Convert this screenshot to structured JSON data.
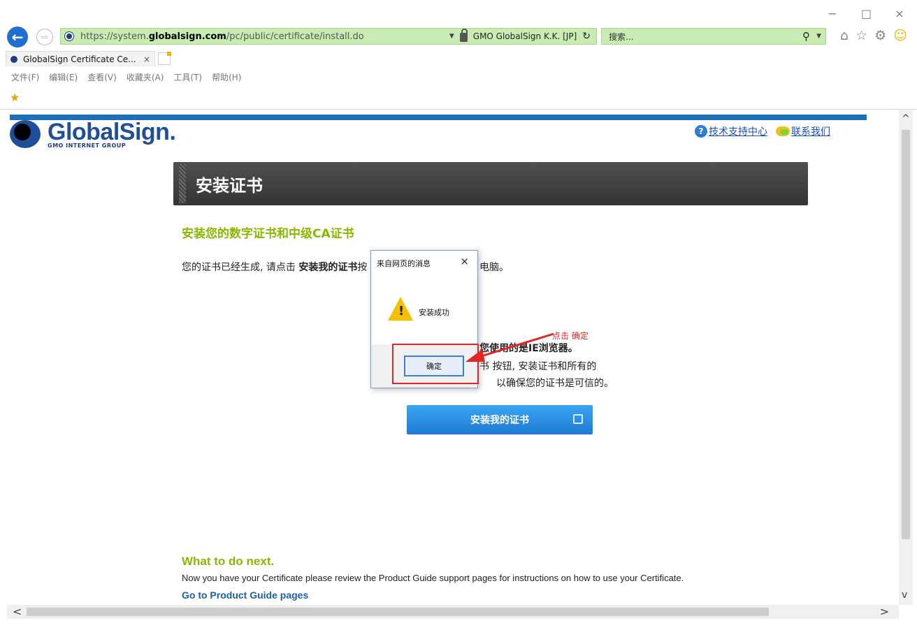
{
  "window": {
    "minimize": "−",
    "maximize": "□",
    "close": "×"
  },
  "address_bar": {
    "url_scheme": "https://",
    "url_sub": "system.",
    "url_host": "globalsign.com",
    "url_path": "/pc/public/certificate/install.do",
    "cert_org": "GMO GlobalSign K.K. [JP]",
    "search_placeholder": "搜索..."
  },
  "tab": {
    "title": "GlobalSign Certificate Ce...",
    "close": "×"
  },
  "menu": [
    "文件(F)",
    "编辑(E)",
    "查看(V)",
    "收藏夹(A)",
    "工具(T)",
    "帮助(H)"
  ],
  "page": {
    "logo_name": "GlobalSign",
    "logo_sub": "GMO INTERNET GROUP",
    "link_support": "技术支持中心",
    "link_contact": "联系我们",
    "banner_title": "安装证书",
    "sub_title": "安装您的数字证书和中级CA证书",
    "desc_prefix": "您的证书已经生成, 请点击 ",
    "desc_bold": "安装我的证书",
    "desc_mid": "按",
    "desc_tail": "电脑。",
    "ie_title": "您使用的是IE浏览器。",
    "ie_line2": "书 按钮, 安装证书和所有的",
    "ie_line3": "以确保您的证书是可信的。",
    "install_button": "安装我的证书",
    "next_title": "What to do next.",
    "next_desc": "Now you have your Certificate please review the Product Guide support pages for instructions on how to use your Certificate.",
    "next_link": "Go to Product Guide pages"
  },
  "dialog": {
    "title": "来自网页的消息",
    "close": "×",
    "message": "安装成功",
    "ok_button": "确定"
  },
  "annotation": {
    "text": "点击 确定"
  },
  "colors": {
    "accent_green": "#8ab800",
    "brand_blue": "#1f4f9a",
    "annotation_red": "#e02626",
    "address_green": "#c9ecb2"
  }
}
